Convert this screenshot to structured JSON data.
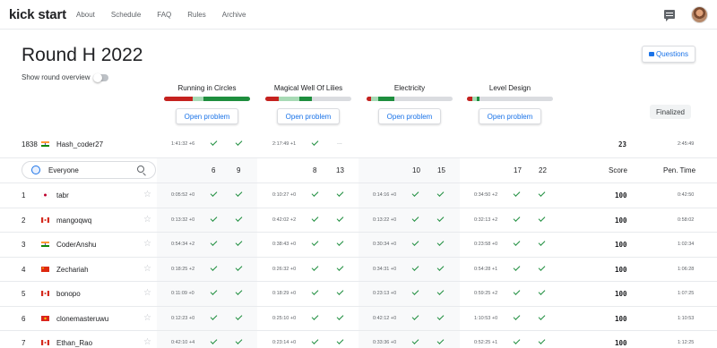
{
  "nav": {
    "brand": "kick start",
    "links": [
      "About",
      "Schedule",
      "FAQ",
      "Rules",
      "Archive"
    ]
  },
  "header": {
    "title": "Round H 2022",
    "questions_label": "Questions",
    "overview_label": "Show round overview",
    "finalized_label": "Finalized"
  },
  "problems": [
    {
      "name": "Running in Circles",
      "open_label": "Open problem",
      "bar": {
        "red": 0.33,
        "light_green": 0.13,
        "dark_green": 0.54
      }
    },
    {
      "name": "Magical Well Of Lilies",
      "open_label": "Open problem",
      "bar": {
        "red": 0.16,
        "light_green": 0.24,
        "dark_green": 0.14
      }
    },
    {
      "name": "Electricity",
      "open_label": "Open problem",
      "bar": {
        "red": 0.05,
        "light_green": 0.09,
        "dark_green": 0.18
      }
    },
    {
      "name": "Level Design",
      "open_label": "Open problem",
      "bar": {
        "red": 0.06,
        "light_green": 0.05,
        "dark_green": 0.04
      }
    }
  ],
  "colors": {
    "red": "#c5221f",
    "light_green": "#a8dab5",
    "dark_green": "#1e8e3e",
    "empty": "#dadce0"
  },
  "self_row": {
    "rank": "1838",
    "name": "Hash_coder27",
    "flag": "IN",
    "p1_time": "1:41:32 +6",
    "p2_time": "2:17:49 +1",
    "p2_set2": "...",
    "score": "23",
    "penalty": "2:45:49"
  },
  "table": {
    "search_label": "Everyone",
    "points": [
      "6",
      "9",
      "8",
      "13",
      "10",
      "15",
      "17",
      "22"
    ],
    "score_header": "Score",
    "penalty_header": "Pen. Time",
    "rows": [
      {
        "rank": "1",
        "name": "tabr",
        "flag": "JP",
        "times": [
          "0:05:52 +0",
          "0:10:27 +0",
          "0:14:16 +0",
          "0:34:50 +2"
        ],
        "score": "100",
        "penalty": "0:42:50"
      },
      {
        "rank": "2",
        "name": "mangoqwq",
        "flag": "CA",
        "times": [
          "0:13:32 +0",
          "0:42:02 +2",
          "0:13:22 +0",
          "0:32:13 +2"
        ],
        "score": "100",
        "penalty": "0:58:02"
      },
      {
        "rank": "3",
        "name": "CoderAnshu",
        "flag": "IN",
        "times": [
          "0:54:34 +2",
          "0:38:43 +0",
          "0:30:34 +0",
          "0:23:58 +0"
        ],
        "score": "100",
        "penalty": "1:02:34"
      },
      {
        "rank": "4",
        "name": "Zechariah",
        "flag": "CN",
        "times": [
          "0:18:25 +2",
          "0:26:32 +0",
          "0:34:31 +0",
          "0:54:28 +1"
        ],
        "score": "100",
        "penalty": "1:06:28"
      },
      {
        "rank": "5",
        "name": "bonopo",
        "flag": "CA",
        "times": [
          "0:11:09 +0",
          "0:18:29 +0",
          "0:23:13 +0",
          "0:59:25 +2"
        ],
        "score": "100",
        "penalty": "1:07:25"
      },
      {
        "rank": "6",
        "name": "clonemasteruwu",
        "flag": "VN",
        "times": [
          "0:12:23 +0",
          "0:25:10 +0",
          "0:42:12 +0",
          "1:10:53 +0"
        ],
        "score": "100",
        "penalty": "1:10:53"
      },
      {
        "rank": "7",
        "name": "Ethan_Rao",
        "flag": "CA",
        "times": [
          "0:42:10 +4",
          "0:23:14 +0",
          "0:33:36 +0",
          "0:52:25 +1"
        ],
        "score": "100",
        "penalty": "1:12:25"
      }
    ]
  }
}
